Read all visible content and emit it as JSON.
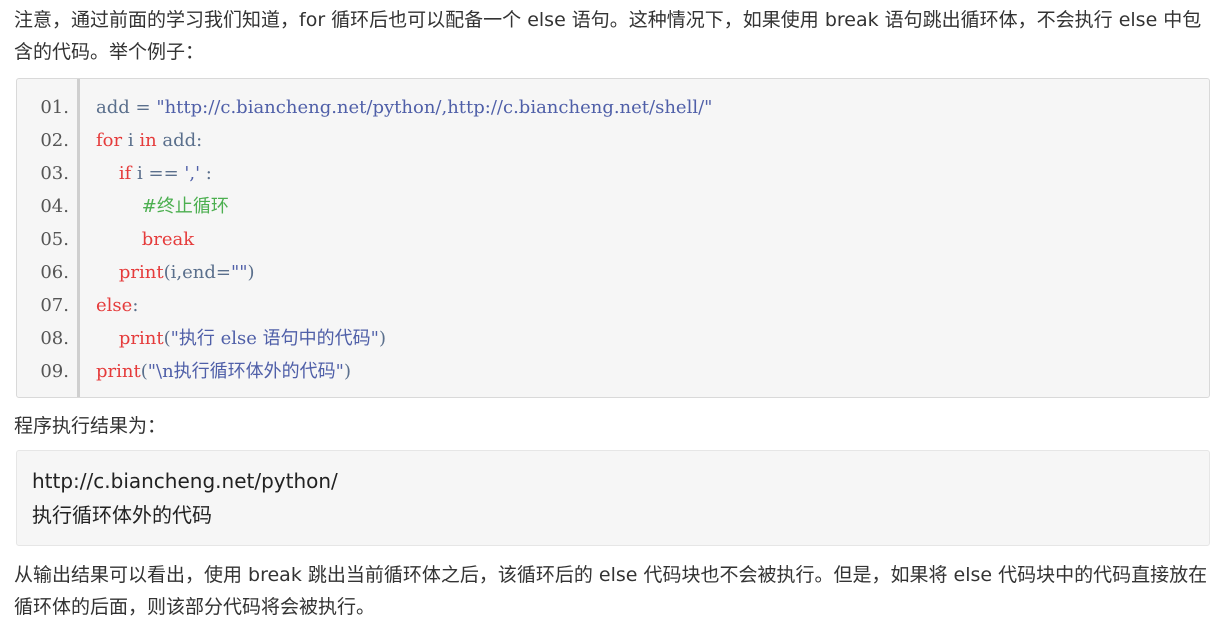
{
  "intro_text": "注意，通过前面的学习我们知道，for 循环后也可以配备一个 else 语句。这种情况下，如果使用 break 语句跳出循环体，不会执行 else 中包含的代码。举个例子：",
  "code_lines": [
    {
      "num": "01.",
      "parts": [
        {
          "t": "add = ",
          "c": "plain"
        },
        {
          "t": "\"http://c.biancheng.net/python/,http://c.biancheng.net/shell/\"",
          "c": "str"
        }
      ]
    },
    {
      "num": "02.",
      "parts": [
        {
          "t": "for",
          "c": "kw"
        },
        {
          "t": " i ",
          "c": "plain"
        },
        {
          "t": "in",
          "c": "kw"
        },
        {
          "t": " add:",
          "c": "plain"
        }
      ]
    },
    {
      "num": "03.",
      "parts": [
        {
          "t": "    ",
          "c": "plain"
        },
        {
          "t": "if",
          "c": "kw"
        },
        {
          "t": " i == ",
          "c": "plain"
        },
        {
          "t": "','",
          "c": "str"
        },
        {
          "t": " :",
          "c": "plain"
        }
      ]
    },
    {
      "num": "04.",
      "parts": [
        {
          "t": "        ",
          "c": "plain"
        },
        {
          "t": "#终止循环",
          "c": "cm"
        }
      ]
    },
    {
      "num": "05.",
      "parts": [
        {
          "t": "        ",
          "c": "plain"
        },
        {
          "t": "break",
          "c": "kw"
        }
      ]
    },
    {
      "num": "06.",
      "parts": [
        {
          "t": "    ",
          "c": "plain"
        },
        {
          "t": "print",
          "c": "kw"
        },
        {
          "t": "(i,end=",
          "c": "plain"
        },
        {
          "t": "\"\"",
          "c": "str"
        },
        {
          "t": ")",
          "c": "plain"
        }
      ]
    },
    {
      "num": "07.",
      "parts": [
        {
          "t": "else",
          "c": "kw"
        },
        {
          "t": ":",
          "c": "plain"
        }
      ]
    },
    {
      "num": "08.",
      "parts": [
        {
          "t": "    ",
          "c": "plain"
        },
        {
          "t": "print",
          "c": "kw"
        },
        {
          "t": "(",
          "c": "plain"
        },
        {
          "t": "\"执行 else 语句中的代码\"",
          "c": "str"
        },
        {
          "t": ")",
          "c": "plain"
        }
      ]
    },
    {
      "num": "09.",
      "parts": [
        {
          "t": "print",
          "c": "kw"
        },
        {
          "t": "(",
          "c": "plain"
        },
        {
          "t": "\"\\n执行循环体外的代码\"",
          "c": "str"
        },
        {
          "t": ")",
          "c": "plain"
        }
      ]
    }
  ],
  "result_label": "程序执行结果为：",
  "output_lines": [
    "http://c.biancheng.net/python/",
    "执行循环体外的代码"
  ],
  "conclusion_text": "从输出结果可以看出，使用 break 跳出当前循环体之后，该循环后的 else 代码块也不会被执行。但是，如果将 else 代码块中的代码直接放在循环体的后面，则该部分代码将会被执行。",
  "colors": {
    "keyword": "#e53b3b",
    "comment": "#4caf50",
    "string": "#4f5fa8",
    "plain": "#5a6f8c"
  }
}
